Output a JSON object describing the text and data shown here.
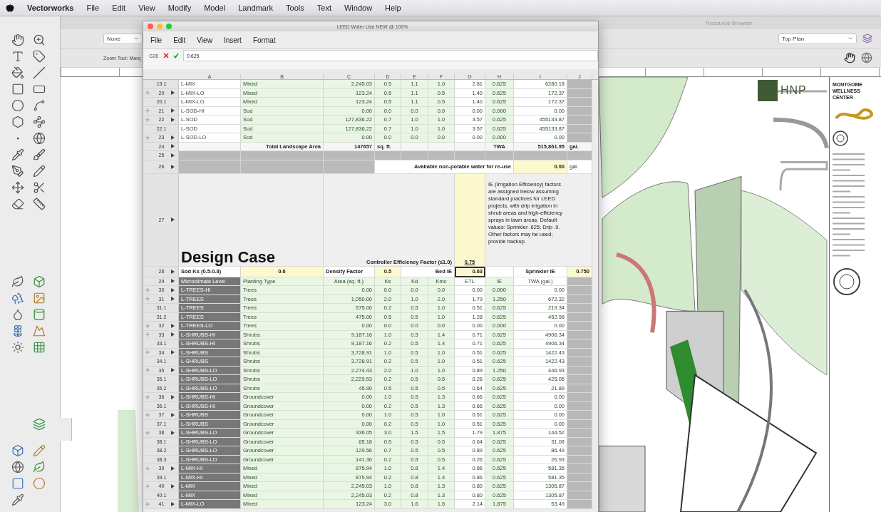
{
  "menubar": {
    "app": "Vectorworks",
    "items": [
      "File",
      "Edit",
      "View",
      "Modify",
      "Model",
      "Landmark",
      "Tools",
      "Text",
      "Window",
      "Help"
    ]
  },
  "workspace": {
    "resource_title": "Resource Browser",
    "class_dropdown": "None",
    "tool_mode": "Zoom Tool: Marq",
    "view_dropdown": "Top Plan"
  },
  "spreadsheet": {
    "title": "LEED Water Use NEW @ 100%",
    "menu": [
      "File",
      "Edit",
      "View",
      "Insert",
      "Format"
    ],
    "cell_ref": "G28",
    "formula": "0.625",
    "columns": [
      "A",
      "B",
      "C",
      "D",
      "E",
      "F",
      "G",
      "H",
      "I",
      "J"
    ],
    "upper_rows": [
      {
        "number": "19.1",
        "expandable": false,
        "shaded": false,
        "cells": [
          "L-MIX",
          "Mixed",
          "2,245.03",
          "0.5",
          "1.1",
          "1.0",
          "2.81",
          "0.625",
          "6280.18"
        ]
      },
      {
        "number": "20",
        "expandable": true,
        "shaded": false,
        "cells": [
          "L-MIX-LO",
          "Mixed",
          "123.24",
          "0.5",
          "1.1",
          "0.5",
          "1.40",
          "0.625",
          "172.37"
        ]
      },
      {
        "number": "20.1",
        "expandable": false,
        "shaded": false,
        "cells": [
          "L-MIX-LO",
          "Mixed",
          "123.24",
          "0.5",
          "1.1",
          "0.5",
          "1.40",
          "0.625",
          "172.37"
        ]
      },
      {
        "number": "21",
        "expandable": true,
        "shaded": false,
        "cells": [
          "L-SOD-HI",
          "Sod",
          "0.00",
          "0.0",
          "0.0",
          "0.0",
          "0.00",
          "0.000",
          "0.00"
        ]
      },
      {
        "number": "22",
        "expandable": true,
        "shaded": false,
        "cells": [
          "L-SOD",
          "Sod",
          "127,836.22",
          "0.7",
          "1.0",
          "1.0",
          "3.57",
          "0.625",
          "455133.87"
        ]
      },
      {
        "number": "22.1",
        "expandable": false,
        "shaded": false,
        "cells": [
          "L-SOD",
          "Sod",
          "127,836.22",
          "0.7",
          "1.0",
          "1.0",
          "3.57",
          "0.625",
          "455133.87"
        ]
      },
      {
        "number": "23",
        "expandable": true,
        "shaded": false,
        "cells": [
          "L-SOD-LO",
          "Sod",
          "0.00",
          "0.0",
          "0.0",
          "0.0",
          "0.00",
          "0.000",
          "0.00"
        ]
      }
    ],
    "total_row": {
      "number": "24",
      "label": "Total Landscape Area",
      "area": "147657",
      "area_unit": "sq. ft.",
      "twa_label": "TWA",
      "twa": "515,861.95",
      "twa_unit": "gal."
    },
    "blank_row": {
      "number": "25"
    },
    "reuse_row": {
      "number": "26",
      "label": "Available non-potable water for re-use",
      "value": "0.00",
      "unit": "gal."
    },
    "heading_row": {
      "number": "27",
      "title": "Design Case",
      "controller_label": "Controller Efficiency Factor (≤1.0)",
      "controller_value": "0.75",
      "note": "IE (Irrigation Efficiency) factors are assigned below assuming standard practices for LEED projects, with drip irrigation in shrub areas and high-efficiency sprays in lawn areas.  Default values: Sprinkler .625; Drip .9. Other factors may be used; provide backup."
    },
    "settings_row": {
      "number": "28",
      "sod_label": "Sod Ks (0.5-0.8)",
      "sod_value": "0.6",
      "density_label": "Density Factor",
      "density_value": "0.5",
      "bed_label": "Bed IE",
      "bed_value": "0.63",
      "bed_selected": true,
      "sprinkler_label": "Sprinkler IE",
      "sprinkler_value": "0.750"
    },
    "header_row": {
      "number": "29",
      "labels": [
        "Microclimate Level",
        "Planting Type",
        "Area (sq. ft.)",
        "Ks",
        "Kd",
        "Kmc",
        "ETL",
        "IE",
        "TWA (gal.)"
      ]
    },
    "lower_rows": [
      {
        "number": "30",
        "expandable": true,
        "shaded": true,
        "cells": [
          "L-TREES-HI",
          "Trees",
          "0.00",
          "0.0",
          "0.0",
          "0.0",
          "0.00",
          "0.000",
          "0.00"
        ]
      },
      {
        "number": "31",
        "expandable": true,
        "shaded": true,
        "cells": [
          "L-TREES",
          "Trees",
          "1,050.00",
          "2.0",
          "1.0",
          "2.0",
          "1.79",
          "1.250",
          "672.32"
        ]
      },
      {
        "number": "31.1",
        "expandable": false,
        "shaded": true,
        "cells": [
          "L-TREES",
          "Trees",
          "575.00",
          "0.2",
          "0.5",
          "1.0",
          "0.51",
          "0.625",
          "219.34"
        ]
      },
      {
        "number": "31.2",
        "expandable": false,
        "shaded": true,
        "cells": [
          "L-TREES",
          "Trees",
          "475.00",
          "0.5",
          "0.5",
          "1.0",
          "1.28",
          "0.625",
          "452.98"
        ]
      },
      {
        "number": "32",
        "expandable": true,
        "shaded": true,
        "cells": [
          "L-TREES-LO",
          "Trees",
          "0.00",
          "0.0",
          "0.0",
          "0.0",
          "0.00",
          "0.000",
          "0.00"
        ]
      },
      {
        "number": "33",
        "expandable": true,
        "shaded": true,
        "cells": [
          "L-SHRUBS-HI",
          "Shrubs",
          "9,187.16",
          "1.0",
          "0.5",
          "1.4",
          "0.71",
          "0.625",
          "4906.34"
        ]
      },
      {
        "number": "33.1",
        "expandable": false,
        "shaded": true,
        "cells": [
          "L-SHRUBS-HI",
          "Shrubs",
          "9,187.16",
          "0.2",
          "0.5",
          "1.4",
          "0.71",
          "0.625",
          "4906.34"
        ]
      },
      {
        "number": "34",
        "expandable": true,
        "shaded": true,
        "cells": [
          "L-SHRUBS",
          "Shrubs",
          "3,728.91",
          "1.0",
          "0.5",
          "1.0",
          "0.51",
          "0.625",
          "1422.43"
        ]
      },
      {
        "number": "34.1",
        "expandable": false,
        "shaded": true,
        "cells": [
          "L-SHRUBS",
          "Shrubs",
          "3,728.91",
          "0.2",
          "0.5",
          "1.0",
          "0.51",
          "0.625",
          "1422.43"
        ]
      },
      {
        "number": "35",
        "expandable": true,
        "shaded": true,
        "cells": [
          "L-SHRUBS-LO",
          "Shrubs",
          "2,274.43",
          "2.0",
          "1.0",
          "1.0",
          "0.89",
          "1.250",
          "446.93"
        ]
      },
      {
        "number": "35.1",
        "expandable": false,
        "shaded": true,
        "cells": [
          "L-SHRUBS-LO",
          "Shrubs",
          "2,229.53",
          "0.2",
          "0.5",
          "0.5",
          "0.26",
          "0.625",
          "425.05"
        ]
      },
      {
        "number": "35.2",
        "expandable": false,
        "shaded": true,
        "cells": [
          "L-SHRUBS-LO",
          "Shrubs",
          "45.90",
          "0.5",
          "0.5",
          "0.5",
          "0.64",
          "0.625",
          "21.89"
        ]
      },
      {
        "number": "36",
        "expandable": true,
        "shaded": true,
        "cells": [
          "L-SHRUBS-HI",
          "Groundcover",
          "0.00",
          "1.0",
          "0.5",
          "1.3",
          "0.66",
          "0.625",
          "0.00"
        ]
      },
      {
        "number": "36.1",
        "expandable": false,
        "shaded": true,
        "cells": [
          "L-SHRUBS-HI",
          "Groundcover",
          "0.00",
          "0.2",
          "0.5",
          "1.3",
          "0.66",
          "0.625",
          "0.00"
        ]
      },
      {
        "number": "37",
        "expandable": true,
        "shaded": true,
        "cells": [
          "L-SHRUBS",
          "Groundcover",
          "0.00",
          "1.0",
          "0.5",
          "1.0",
          "0.51",
          "0.625",
          "0.00"
        ]
      },
      {
        "number": "37.1",
        "expandable": false,
        "shaded": true,
        "cells": [
          "L-SHRUBS",
          "Groundcover",
          "0.00",
          "0.2",
          "0.5",
          "1.0",
          "0.51",
          "0.625",
          "0.00"
        ]
      },
      {
        "number": "38",
        "expandable": true,
        "shaded": true,
        "cells": [
          "L-SHRUBS-LO",
          "Groundcover",
          "336.05",
          "3.0",
          "1.5",
          "1.5",
          "1.79",
          "1.875",
          "144.52"
        ]
      },
      {
        "number": "38.1",
        "expandable": false,
        "shaded": true,
        "cells": [
          "L-SHRUBS-LO",
          "Groundcover",
          "65.18",
          "0.5",
          "0.5",
          "0.5",
          "0.64",
          "0.625",
          "31.08"
        ]
      },
      {
        "number": "38.2",
        "expandable": false,
        "shaded": true,
        "cells": [
          "L-SHRUBS-LO",
          "Groundcover",
          "129.56",
          "0.7",
          "0.5",
          "0.5",
          "0.89",
          "0.625",
          "86.49"
        ]
      },
      {
        "number": "38.3",
        "expandable": false,
        "shaded": true,
        "cells": [
          "L-SHRUBS-LO",
          "Groundcover",
          "141.30",
          "0.2",
          "0.5",
          "0.5",
          "0.26",
          "0.625",
          "26.93"
        ]
      },
      {
        "number": "39",
        "expandable": true,
        "shaded": true,
        "cells": [
          "L-MIX-HI",
          "Mixed",
          "875.94",
          "1.0",
          "0.8",
          "1.4",
          "0.86",
          "0.625",
          "581.35"
        ]
      },
      {
        "number": "39.1",
        "expandable": false,
        "shaded": true,
        "cells": [
          "L-MIX-HI",
          "Mixed",
          "875.94",
          "0.2",
          "0.8",
          "1.4",
          "0.86",
          "0.625",
          "581.35"
        ]
      },
      {
        "number": "40",
        "expandable": true,
        "shaded": true,
        "cells": [
          "L-MIX",
          "Mixed",
          "2,245.03",
          "1.0",
          "0.8",
          "1.3",
          "0.80",
          "0.625",
          "1305.87"
        ]
      },
      {
        "number": "40.1",
        "expandable": false,
        "shaded": true,
        "cells": [
          "L-MIX",
          "Mixed",
          "2,245.03",
          "0.2",
          "0.8",
          "1.3",
          "0.80",
          "0.625",
          "1305.87"
        ]
      },
      {
        "number": "41",
        "expandable": true,
        "shaded": true,
        "cells": [
          "L-MIX-LO",
          "Mixed",
          "123.24",
          "3.0",
          "1.6",
          "1.5",
          "2.14",
          "1.875",
          "53.49"
        ]
      }
    ]
  },
  "title_block": {
    "logo": "HNP",
    "project": [
      "MONTGOME",
      "WELLNESS",
      "CENTER"
    ]
  }
}
